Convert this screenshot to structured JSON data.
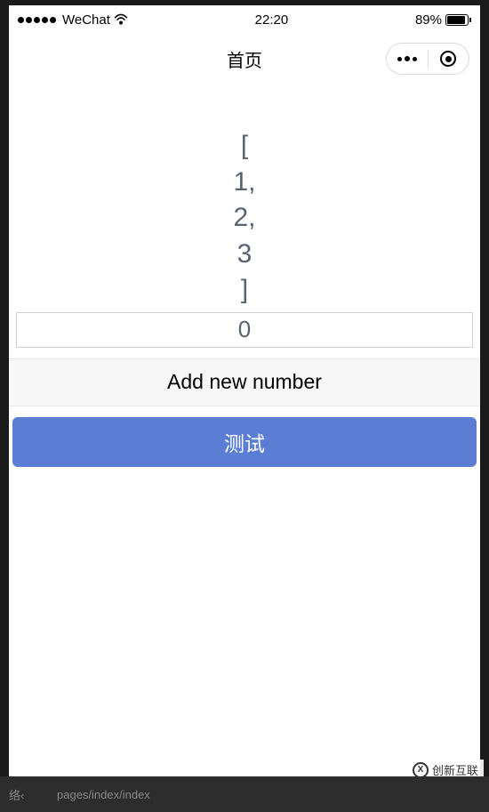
{
  "status_bar": {
    "carrier": "WeChat",
    "time": "22:20",
    "battery_pct": "89%"
  },
  "nav": {
    "title": "首页"
  },
  "main": {
    "array_display_lines": [
      "[",
      "1,",
      "2,",
      "3",
      "]"
    ],
    "input_value": "0",
    "add_button_label": "Add new number",
    "test_button_label": "测试"
  },
  "footer": {
    "path": "pages/index/index"
  },
  "watermark": {
    "text": "创新互联"
  },
  "colors": {
    "primary_button": "#5b7dd4",
    "text_muted": "#5a6370"
  }
}
